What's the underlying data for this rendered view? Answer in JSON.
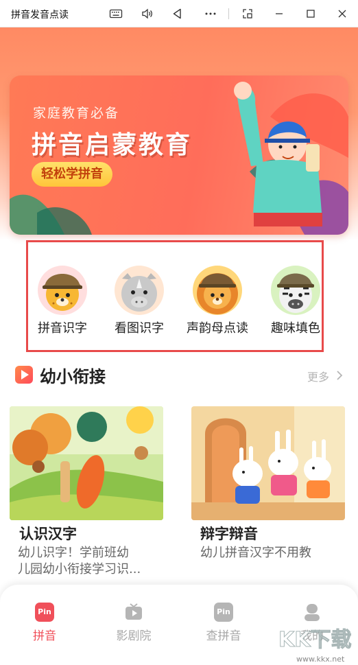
{
  "window": {
    "title": "拼音发音点读"
  },
  "banner": {
    "subtitle": "家庭教育必备",
    "headline": "拼音启蒙教育",
    "pill": "轻松学拼音"
  },
  "categories": [
    {
      "label": "拼音识字",
      "icon": "leopard-face-icon"
    },
    {
      "label": "看图识字",
      "icon": "rhino-face-icon"
    },
    {
      "label": "声韵母点读",
      "icon": "lion-face-icon"
    },
    {
      "label": "趣味填色",
      "icon": "zebra-face-icon"
    }
  ],
  "section": {
    "title": "幼小衔接",
    "more": "更多"
  },
  "cards": [
    {
      "title": "认识汉字",
      "desc_line1": "幼儿识字！学前班幼",
      "desc_line2": "儿园幼小衔接学习识..."
    },
    {
      "title": "辩字辩音",
      "desc_line1": "幼儿拼音汉字不用教",
      "desc_line2": ""
    }
  ],
  "nav": [
    {
      "label": "拼音",
      "badge": "Pin",
      "active": true
    },
    {
      "label": "影剧院",
      "badge": "",
      "active": false
    },
    {
      "label": "查拼音",
      "badge": "Pin",
      "active": false
    },
    {
      "label": "我的",
      "badge": "",
      "active": false
    }
  ],
  "watermark": "KK下载",
  "colors": {
    "accent": "#ff6d5a",
    "nav_active": "#f0505a",
    "nav_inactive": "#a8a8a8",
    "highlight_border": "#e84a4a"
  }
}
